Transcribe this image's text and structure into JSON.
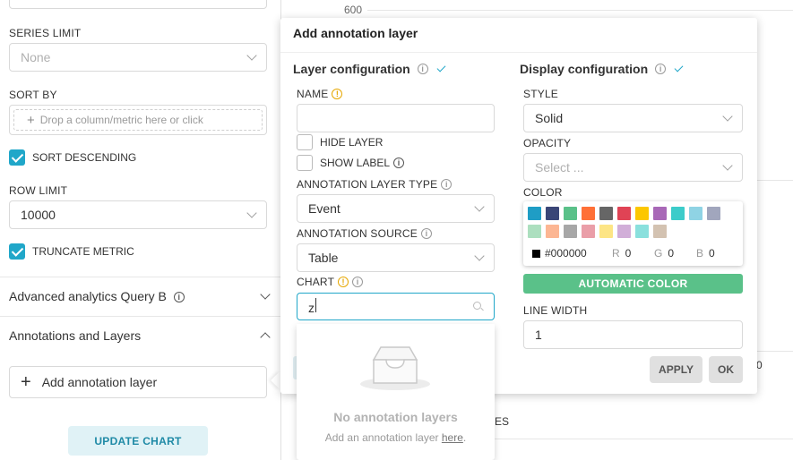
{
  "control_panel": {
    "series_limit": {
      "label": "SERIES LIMIT",
      "placeholder": "None"
    },
    "sort_by": {
      "label": "SORT BY",
      "placeholder": "Drop a column/metric here or click"
    },
    "sort_descending": {
      "label": "SORT DESCENDING",
      "checked": true
    },
    "row_limit": {
      "label": "ROW LIMIT",
      "value": "10000"
    },
    "truncate_metric": {
      "label": "TRUNCATE METRIC",
      "checked": true
    },
    "advanced_analytics": {
      "label": "Advanced analytics Query B"
    },
    "annotations": {
      "label": "Annotations and Layers"
    },
    "add_annotation_layer": "Add annotation layer",
    "update_chart": "UPDATE CHART"
  },
  "chart_background": {
    "tick_600": "600",
    "fragment_right": "0",
    "fragment_es": "ES"
  },
  "popover": {
    "title": "Add annotation layer",
    "layer_config": {
      "title": "Layer configuration",
      "name_label": "NAME",
      "name_value": "",
      "hide_layer_label": "HIDE LAYER",
      "show_label_label": "SHOW LABEL",
      "layer_type_label": "ANNOTATION LAYER TYPE",
      "layer_type_value": "Event",
      "source_label": "ANNOTATION SOURCE",
      "source_value": "Table",
      "chart_label": "CHART",
      "chart_search_value": "z"
    },
    "display_config": {
      "title": "Display configuration",
      "style_label": "STYLE",
      "style_value": "Solid",
      "opacity_label": "OPACITY",
      "opacity_placeholder": "Select ...",
      "color_label": "COLOR",
      "hex_value": "#000000",
      "r_label": "R",
      "r_value": "0",
      "g_label": "G",
      "g_value": "0",
      "b_label": "B",
      "b_value": "0",
      "automatic_color": "AUTOMATIC COLOR",
      "line_width_label": "LINE WIDTH",
      "line_width_value": "1"
    },
    "apply": "APPLY",
    "ok": "OK"
  },
  "dropdown": {
    "empty_title": "No annotation layers",
    "empty_text": "Add an annotation layer",
    "empty_link": "here",
    "empty_end": "."
  },
  "swatch_colors": [
    "#1f9dc5",
    "#3a4677",
    "#5ac189",
    "#ff7037",
    "#666666",
    "#e04355",
    "#fcc700",
    "#a868b7",
    "#3cccca",
    "#8fd3e4",
    "#a1a6bd",
    "#acdfbf",
    "#fcb693",
    "#a7a7a7",
    "#ea9ea8",
    "#fde585",
    "#d1aed8",
    "#8ae0dd",
    "#d3c2b1"
  ]
}
